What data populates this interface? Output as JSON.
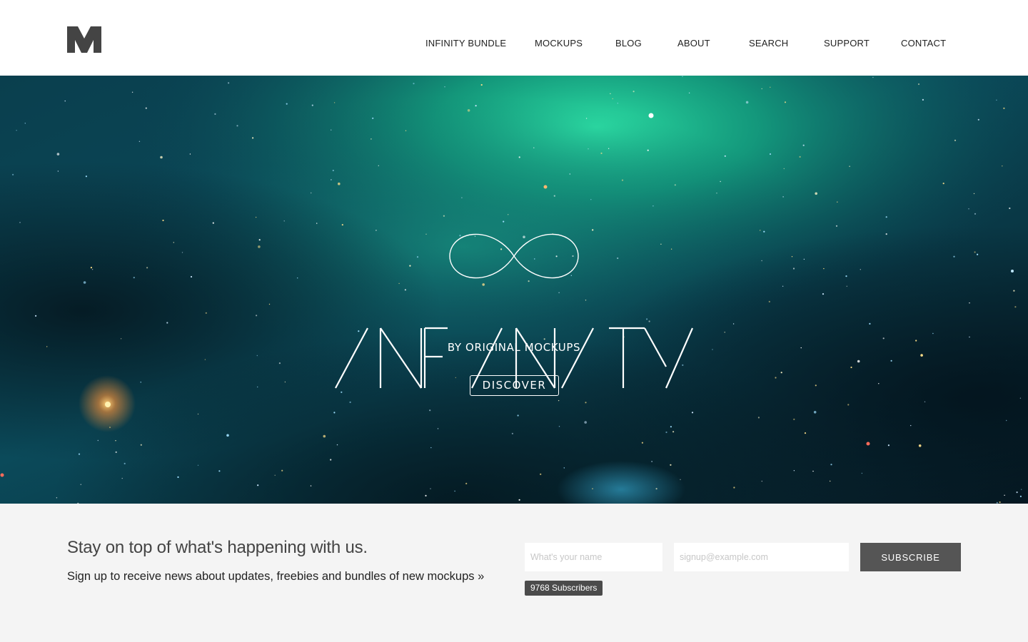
{
  "brand": {
    "logo_icon": "m-logo-icon"
  },
  "nav": {
    "items": [
      {
        "label": "INFINITY BUNDLE"
      },
      {
        "label": "MOCKUPS"
      },
      {
        "label": "BLOG"
      },
      {
        "label": "ABOUT"
      },
      {
        "label": "SEARCH"
      },
      {
        "label": "SUPPORT"
      },
      {
        "label": "CONTACT"
      }
    ]
  },
  "hero": {
    "icon": "infinity-icon",
    "wordmark": "INFINITY",
    "byline": "BY ORIGINAL MOCKUPS",
    "cta_label": "DISCOVER",
    "colors": {
      "deep": "#06222c",
      "mid": "#0c4a5a",
      "glow": "#1fd49a"
    }
  },
  "newsletter": {
    "title": "Stay on top of what's happening with us.",
    "text": "Sign up to receive news about updates, freebies and bundles of new mockups »",
    "name_placeholder": "What's your name",
    "email_placeholder": "signup@example.com",
    "button_label": "SUBSCRIBE",
    "subscribers": "9768 Subscribers"
  }
}
